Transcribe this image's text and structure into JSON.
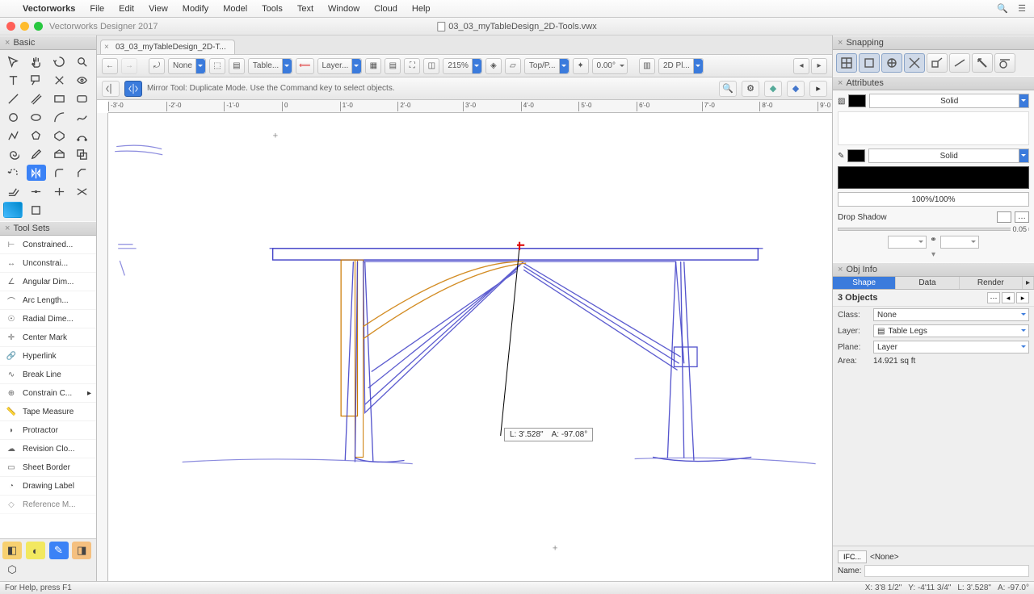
{
  "menubar": {
    "items": [
      "Vectorworks",
      "File",
      "Edit",
      "View",
      "Modify",
      "Model",
      "Tools",
      "Text",
      "Window",
      "Cloud",
      "Help"
    ]
  },
  "titlebar": {
    "app": "Vectorworks Designer 2017",
    "file": "03_03_myTableDesign_2D-Tools.vwx"
  },
  "tab": {
    "label": "03_03_myTableDesign_2D-T..."
  },
  "viewbar": {
    "class": "None",
    "layer": "Table...",
    "layerMenu": "Layer...",
    "view": "Top/P...",
    "angle": "0.00°",
    "zoom": "215%",
    "render": "2D Pl..."
  },
  "modebar": {
    "hint": "Mirror Tool: Duplicate Mode. Use the Command key to select objects."
  },
  "ruler": {
    "ticks": [
      "-3'-0",
      "-2'-0",
      "-1'-0",
      "0",
      "1'-0",
      "2'-0",
      "3'-0",
      "4'-0",
      "5'-0",
      "6'-0",
      "7'-0",
      "8'-0",
      "9'-0"
    ]
  },
  "measure": {
    "L": "3'.528\"",
    "A": "-97.08°"
  },
  "left": {
    "basic": "Basic",
    "toolsets_hdr": "Tool Sets",
    "toolsets": [
      "Constrained...",
      "Unconstrai...",
      "Angular Dim...",
      "Arc Length...",
      "Radial Dime...",
      "Center Mark",
      "Hyperlink",
      "Break Line",
      "Constrain C...",
      "Tape Measure",
      "Protractor",
      "Revision Clo...",
      "Sheet Border",
      "Drawing Label",
      "Reference M..."
    ]
  },
  "snapping": {
    "hdr": "Snapping"
  },
  "attributes": {
    "hdr": "Attributes",
    "fill": "Solid",
    "stroke": "Solid",
    "opacity": "100%/100%",
    "dropshadow": "Drop Shadow",
    "dsval": "0.05"
  },
  "objinfo": {
    "hdr": "Obj Info",
    "tabs": [
      "Shape",
      "Data",
      "Render"
    ],
    "count": "3 Objects",
    "class": "None",
    "layer": "Table Legs",
    "plane": "Layer",
    "area_label": "Area:",
    "area": "14.921 sq ft",
    "ifc_label": "IFC...",
    "ifc": "<None>",
    "name_label": "Name:"
  },
  "status": {
    "help": "For Help, press F1",
    "x": "X:   3'8 1/2\"",
    "y": "Y:   -4'11 3/4\"",
    "l": "L:   3'.528\"",
    "a": "A:   -97.0°"
  }
}
